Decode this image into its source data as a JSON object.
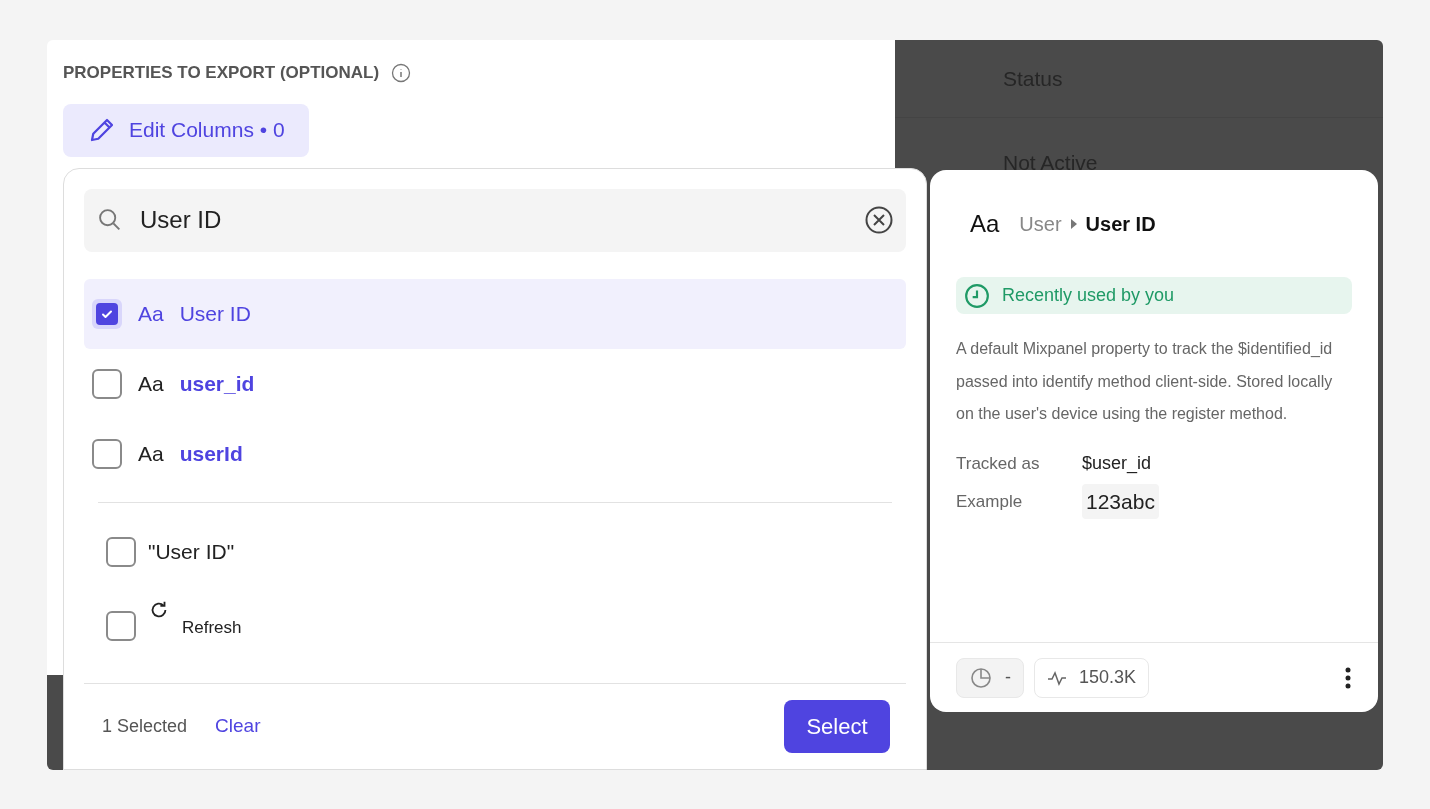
{
  "section": {
    "title": "PROPERTIES TO EXPORT (OPTIONAL)",
    "edit_button": "Edit Columns • 0"
  },
  "background_table": {
    "header": "Status",
    "cell": "Not Active"
  },
  "dropdown": {
    "search_value": "User ID",
    "options": [
      {
        "kind": "property",
        "type_glyph": "Aa",
        "label": "User ID",
        "checked": true,
        "selected": true
      },
      {
        "kind": "property",
        "type_glyph": "Aa",
        "label": "user_id",
        "checked": false,
        "selected": false
      },
      {
        "kind": "property",
        "type_glyph": "Aa",
        "label": "userId",
        "checked": false,
        "selected": false
      }
    ],
    "extra_options": [
      {
        "kind": "literal",
        "label": "\"User ID\"",
        "checked": false
      },
      {
        "kind": "refresh",
        "label": "Refresh",
        "checked": false
      }
    ],
    "footer": {
      "count": "1 Selected",
      "clear": "Clear",
      "select": "Select"
    }
  },
  "detail": {
    "type_glyph": "Aa",
    "breadcrumb_parent": "User",
    "title": "User ID",
    "badge": "Recently used by you",
    "description": "A default Mixpanel property to track the $identified_id passed into identify method client-side. Stored locally on the user's device using the register method.",
    "fields": [
      {
        "kind": "plain",
        "label": "Tracked as",
        "value": "$user_id"
      },
      {
        "kind": "chip",
        "label": "Example",
        "value": "123abc"
      }
    ],
    "footer_chips": [
      {
        "kind": "pie",
        "text": "-"
      },
      {
        "kind": "activity",
        "text": "150.3K"
      }
    ]
  }
}
